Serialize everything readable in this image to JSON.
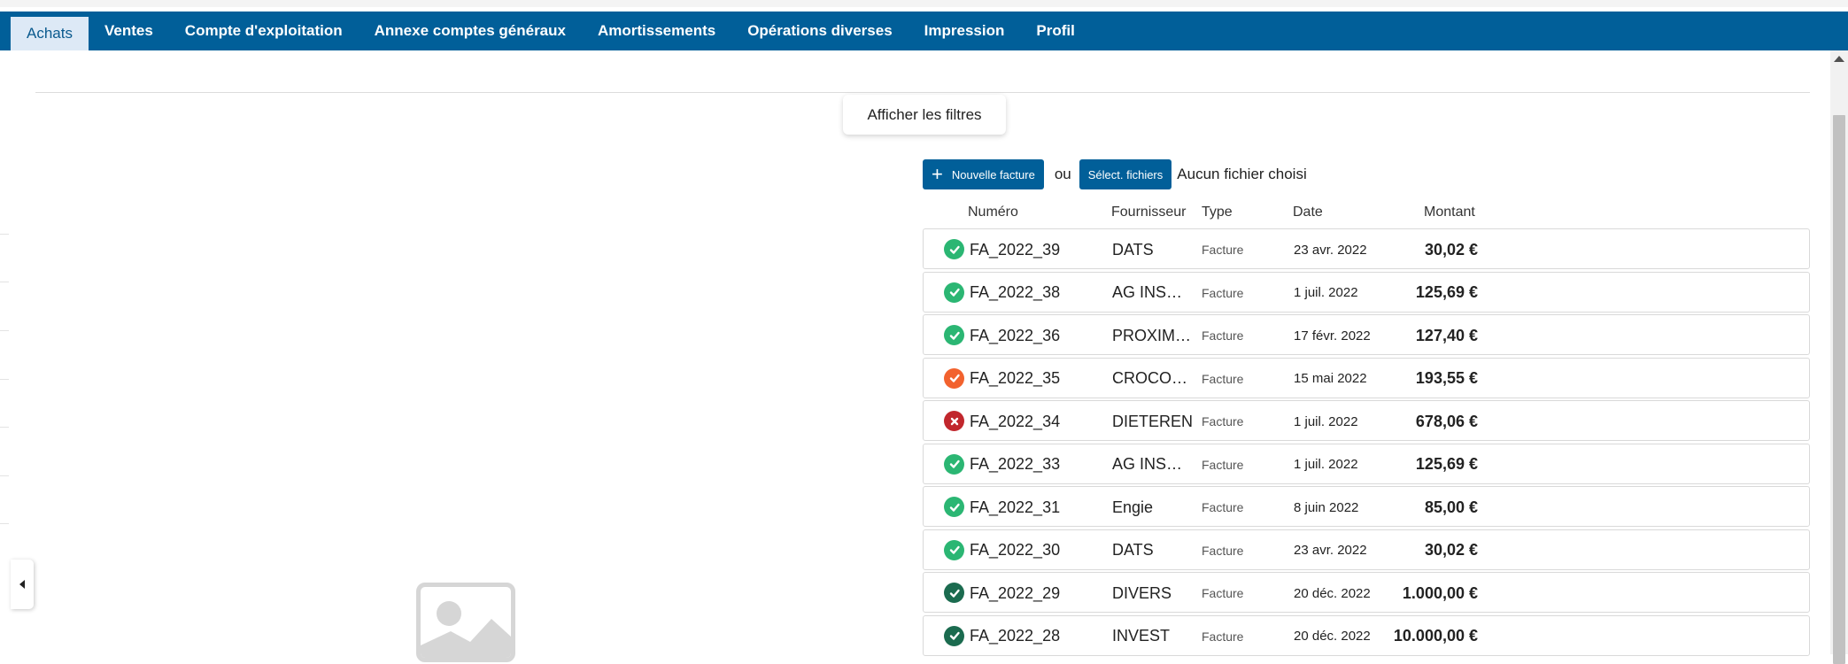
{
  "nav": {
    "tabs": [
      {
        "label": "Achats",
        "active": true
      },
      {
        "label": "Ventes",
        "active": false
      },
      {
        "label": "Compte d'exploitation",
        "active": false
      },
      {
        "label": "Annexe comptes généraux",
        "active": false
      },
      {
        "label": "Amortissements",
        "active": false
      },
      {
        "label": "Opérations diverses",
        "active": false
      },
      {
        "label": "Impression",
        "active": false
      },
      {
        "label": "Profil",
        "active": false
      }
    ]
  },
  "filters": {
    "show_label": "Afficher les filtres"
  },
  "actions": {
    "new_invoice_label": "Nouvelle facture",
    "or_label": "ou",
    "select_files_label": "Sélect. fichiers",
    "no_file_label": "Aucun fichier choisi"
  },
  "table": {
    "headers": {
      "number": "Numéro",
      "supplier": "Fournisseur",
      "type": "Type",
      "date": "Date",
      "amount": "Montant"
    },
    "rows": [
      {
        "number": "FA_2022_39",
        "supplier": "DATS",
        "type": "Facture",
        "date": "23 avr. 2022",
        "amount": "30,02 €",
        "status": "validated"
      },
      {
        "number": "FA_2022_38",
        "supplier": "AG INS…",
        "type": "Facture",
        "date": "1 juil. 2022",
        "amount": "125,69 €",
        "status": "validated"
      },
      {
        "number": "FA_2022_36",
        "supplier": "PROXIM…",
        "type": "Facture",
        "date": "17 févr. 2022",
        "amount": "127,40 €",
        "status": "validated"
      },
      {
        "number": "FA_2022_35",
        "supplier": "CROCO…",
        "type": "Facture",
        "date": "15 mai 2022",
        "amount": "193,55 €",
        "status": "warning"
      },
      {
        "number": "FA_2022_34",
        "supplier": "DIETEREN",
        "type": "Facture",
        "date": "1 juil. 2022",
        "amount": "678,06 €",
        "status": "error"
      },
      {
        "number": "FA_2022_33",
        "supplier": "AG INS…",
        "type": "Facture",
        "date": "1 juil. 2022",
        "amount": "125,69 €",
        "status": "validated"
      },
      {
        "number": "FA_2022_31",
        "supplier": "Engie",
        "type": "Facture",
        "date": "8 juin 2022",
        "amount": "85,00 €",
        "status": "validated"
      },
      {
        "number": "FA_2022_30",
        "supplier": "DATS",
        "type": "Facture",
        "date": "23 avr. 2022",
        "amount": "30,02 €",
        "status": "validated"
      },
      {
        "number": "FA_2022_29",
        "supplier": "DIVERS",
        "type": "Facture",
        "date": "20 déc. 2022",
        "amount": "1.000,00 €",
        "status": "validated-dark"
      },
      {
        "number": "FA_2022_28",
        "supplier": "INVEST",
        "type": "Facture",
        "date": "20 déc. 2022",
        "amount": "10.000,00 €",
        "status": "validated-dark"
      }
    ]
  },
  "colors": {
    "nav_bg": "#015f99",
    "validated": "#2bb673",
    "warning": "#f2622e",
    "error": "#c1272d",
    "validated_dark": "#1b6b4f"
  },
  "icons": {
    "validated": "check-circle-icon",
    "warning": "check-circle-icon",
    "error": "x-circle-icon",
    "validated_dark": "check-circle-icon",
    "collapse": "caret-left-icon",
    "placeholder": "image-placeholder-icon",
    "add": "plus-icon"
  }
}
